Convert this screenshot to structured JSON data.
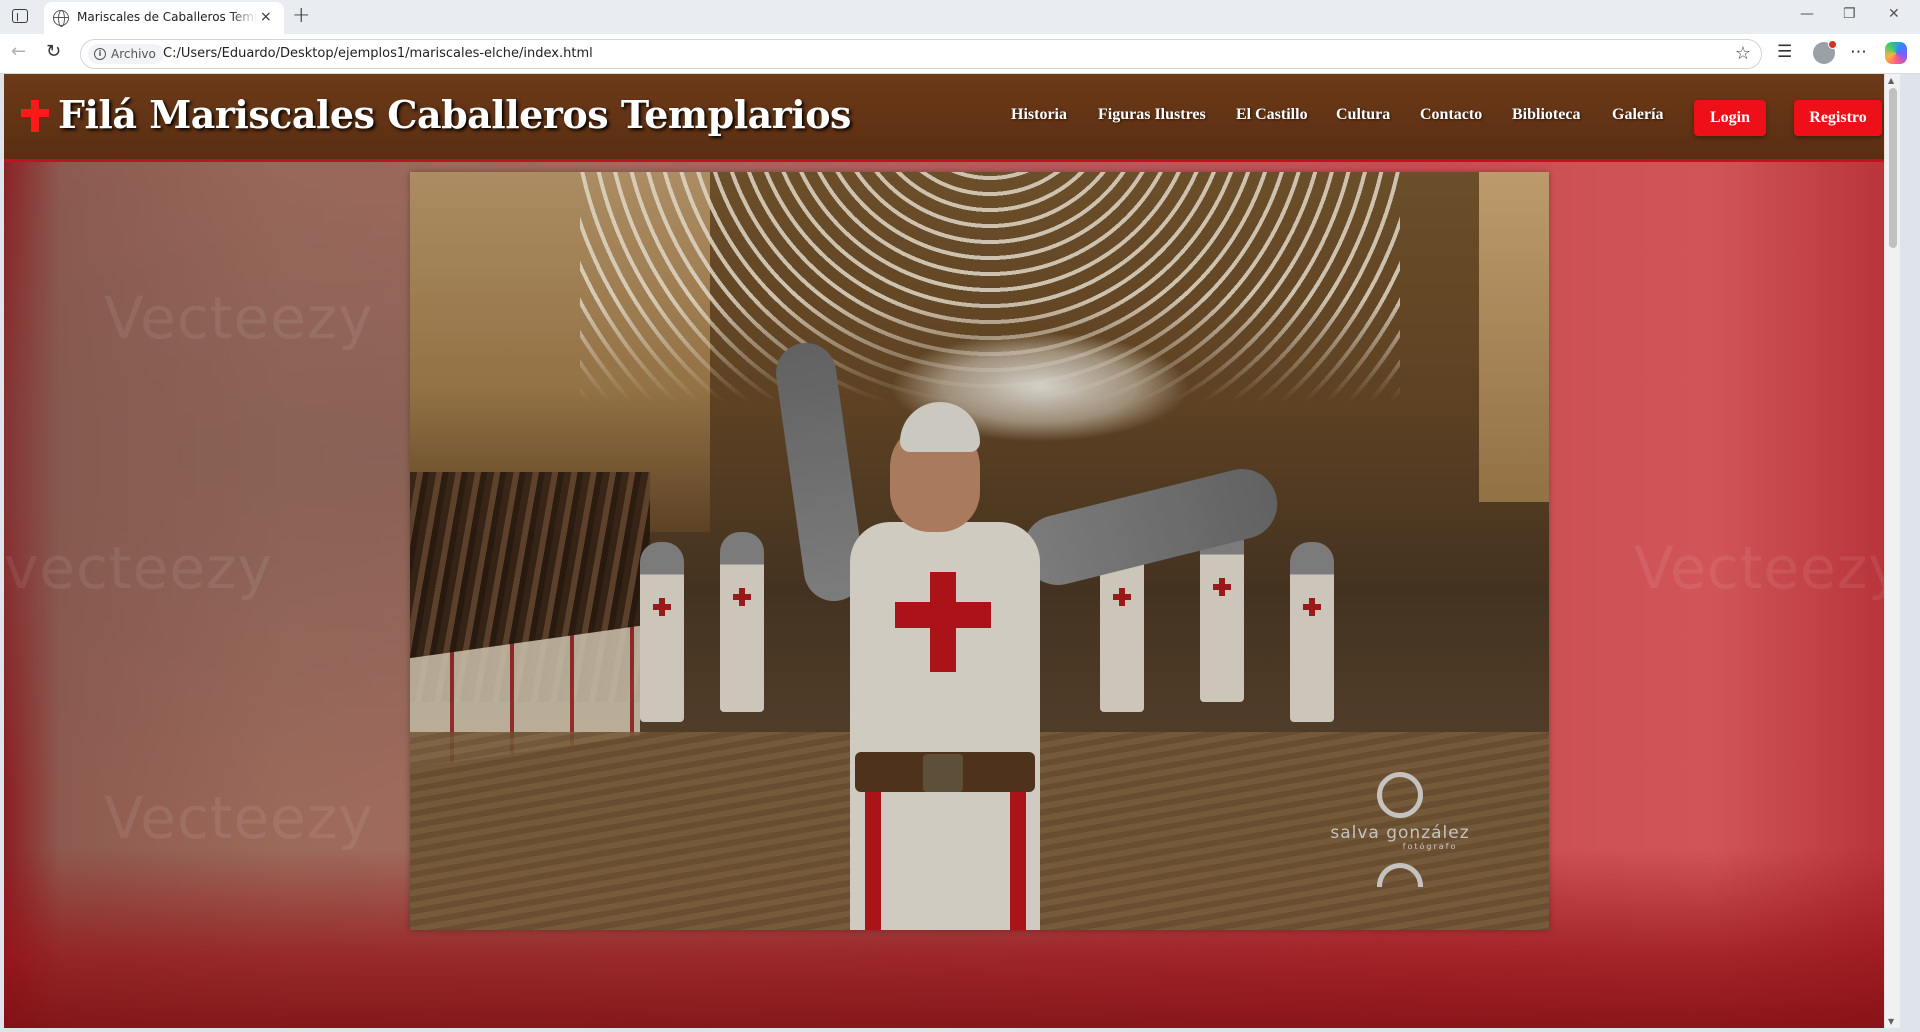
{
  "browser": {
    "tab_title": "Mariscales de Caballeros Templarios",
    "tab_close": "×",
    "new_tab": "+",
    "address_info_label": "Archivo",
    "url": "C:/Users/Eduardo/Desktop/ejemplos1/mariscales-elche/index.html",
    "window_controls": {
      "minimize": "—",
      "restore": "❐",
      "close": "✕"
    }
  },
  "site": {
    "brand_title": "Filá Mariscales Caballeros Templarios",
    "nav": [
      {
        "label": "Historia"
      },
      {
        "label": "Figuras Ilustres"
      },
      {
        "label": "El Castillo"
      },
      {
        "label": "Cultura"
      },
      {
        "label": "Contacto"
      },
      {
        "label": "Biblioteca"
      },
      {
        "label": "Galería"
      }
    ],
    "login_label": "Login",
    "register_label": "Registro",
    "colors": {
      "header_bg": "#5f3114",
      "accent_red": "#ee0f18",
      "cross_red": "#ff1a1a"
    }
  },
  "hero": {
    "photo_watermark_name": "salva gonzález",
    "photo_watermark_sub": "fotógrafo"
  },
  "background_watermarks": [
    "Vecteezy",
    "vecteezy",
    "Vecteezy"
  ]
}
